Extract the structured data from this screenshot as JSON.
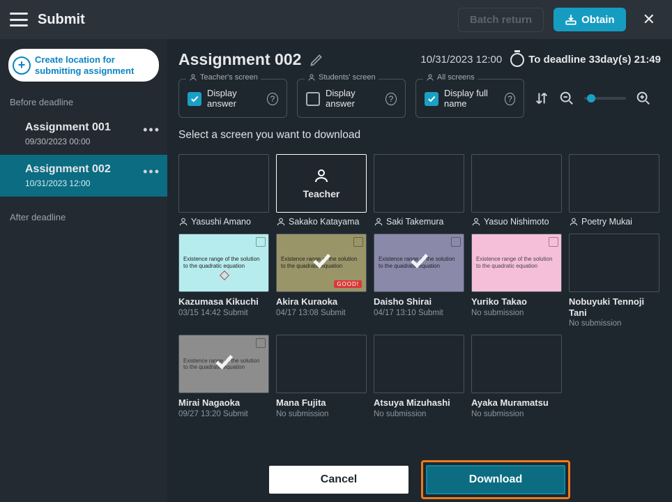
{
  "topbar": {
    "title": "Submit",
    "batch_return": "Batch return",
    "obtain": "Obtain"
  },
  "sidebar": {
    "create_button": "Create location for submitting assignment",
    "before_label": "Before deadline",
    "after_label": "After deadline",
    "items": [
      {
        "name": "Assignment 001",
        "date": "09/30/2023 00:00",
        "selected": false
      },
      {
        "name": "Assignment 002",
        "date": "10/31/2023 12:00",
        "selected": true
      }
    ]
  },
  "header": {
    "assignment_title": "Assignment 002",
    "due_datetime": "10/31/2023 12:00",
    "deadline_text": "To deadline 33day(s) 21:49"
  },
  "options": {
    "teacher_legend": "Teacher's screen",
    "students_legend": "Students' screen",
    "all_legend": "All screens",
    "display_answer": "Display answer",
    "display_full_name": "Display full name",
    "teacher_checked": true,
    "students_checked": false,
    "all_checked": true
  },
  "prompt": "Select a screen you want to download",
  "grid": {
    "row1": [
      {
        "name": "Yasushi Amano"
      },
      {
        "name": "Sakako Katayama",
        "teacher": true,
        "teacher_label": "Teacher",
        "selected": true
      },
      {
        "name": "Saki Takemura"
      },
      {
        "name": "Yasuo Nishimoto"
      },
      {
        "name": "Poetry Mukai"
      }
    ],
    "row2": [
      {
        "name": "Kazumasa Kikuchi",
        "sub": "03/15 14:42 Submit",
        "thumb": "cyan"
      },
      {
        "name": "Akira Kuraoka",
        "sub": "04/17 13:08 Submit",
        "thumb": "olive",
        "checked": true,
        "good": "GOOD!"
      },
      {
        "name": "Daisho Shirai",
        "sub": "04/17 13:10 Submit",
        "thumb": "violet",
        "checked": true
      },
      {
        "name": "Yuriko Takao",
        "sub": "No submission",
        "thumb": "pink"
      },
      {
        "name": "Nobuyuki Tennoji Tani",
        "sub": "No submission"
      }
    ],
    "row3": [
      {
        "name": "Mirai Nagaoka",
        "sub": "09/27 13:20 Submit",
        "thumb": "grey",
        "checked": true
      },
      {
        "name": "Mana Fujita",
        "sub": "No submission"
      },
      {
        "name": "Atsuya Mizuhashi",
        "sub": "No submission"
      },
      {
        "name": "Ayaka Muramatsu",
        "sub": "No submission"
      }
    ],
    "note_text": "Existence range of the solution to the quadratic equation"
  },
  "footer": {
    "cancel": "Cancel",
    "download": "Download"
  }
}
